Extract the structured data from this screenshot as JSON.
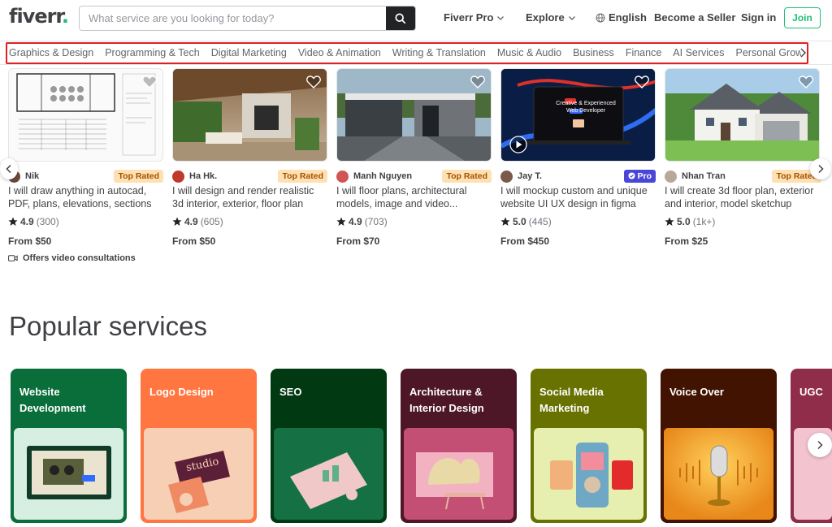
{
  "header": {
    "logo_text": "fiverr",
    "logo_dot": ".",
    "search_placeholder": "What service are you looking for today?",
    "nav": {
      "fiverr_pro": "Fiverr Pro",
      "explore": "Explore",
      "language": "English",
      "become_seller": "Become a Seller",
      "sign_in": "Sign in",
      "join": "Join"
    }
  },
  "categories": [
    "Graphics & Design",
    "Programming & Tech",
    "Digital Marketing",
    "Video & Animation",
    "Writing & Translation",
    "Music & Audio",
    "Business",
    "Finance",
    "AI Services",
    "Personal Growth"
  ],
  "gigs": [
    {
      "seller": "Nik",
      "badge": "Top Rated",
      "title": "I will draw anything in autocad, PDF, plans, elevations, sections",
      "rating": "4.9",
      "reviews": "(300)",
      "price": "From $50",
      "extra": "Offers video consultations",
      "avatar_color": "#6b4a3a"
    },
    {
      "seller": "Ha Hk.",
      "badge": "Top Rated",
      "title": "I will design and render realistic 3d interior, exterior, floor plan",
      "rating": "4.9",
      "reviews": "(605)",
      "price": "From $50",
      "avatar_color": "#c0392b"
    },
    {
      "seller": "Manh Nguyen",
      "badge": "Top Rated",
      "title": "I will floor plans, architectural models, image and video...",
      "rating": "4.9",
      "reviews": "(703)",
      "price": "From $70",
      "avatar_color": "#d35454"
    },
    {
      "seller": "Jay T.",
      "badge": "Pro",
      "title": "I will mockup custom and unique website UI UX design in figma",
      "rating": "5.0",
      "reviews": "(445)",
      "price": "From $450",
      "avatar_color": "#7a5a48",
      "thumb_text_1": "Creative & Experienced",
      "thumb_text_2": "Web Developer"
    },
    {
      "seller": "Nhan Tran",
      "badge": "Top Rated",
      "title": "I will create 3d floor plan, exterior and interior, model sketchup",
      "rating": "5.0",
      "reviews": "(1k+)",
      "price": "From $25",
      "avatar_color": "#b8a89a"
    }
  ],
  "popular": {
    "title": "Popular services",
    "items": [
      {
        "label": "Website Development",
        "color": "#0a6e3a",
        "inner": "#d7efe3"
      },
      {
        "label": "Logo Design",
        "color": "#ff7640",
        "inner": "#f6cfb5"
      },
      {
        "label": "SEO",
        "color": "#003912",
        "inner": "#1b7a4a"
      },
      {
        "label": "Architecture & Interior Design",
        "color": "#4d1727",
        "inner": "#c44f74"
      },
      {
        "label": "Social Media Marketing",
        "color": "#687200",
        "inner": "#e6efb0"
      },
      {
        "label": "Voice Over",
        "color": "#421300",
        "inner": "#f2a624"
      },
      {
        "label": "UGC",
        "color": "#8f2d4a",
        "inner": "#f3c3d0"
      }
    ],
    "logo_card_text": "studio"
  },
  "icons": {
    "star": "star-icon",
    "heart": "heart-icon",
    "search": "search-icon",
    "globe": "globe-icon",
    "video": "video-icon"
  },
  "colors": {
    "brand_green": "#1dbf73",
    "highlight_red": "#e02020"
  }
}
